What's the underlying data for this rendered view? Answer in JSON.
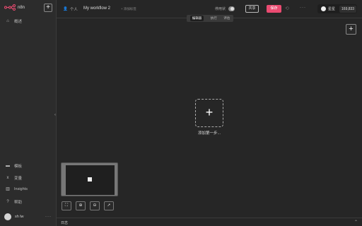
{
  "app": {
    "logo_text": "n8n",
    "brand_color": "#ea4b71"
  },
  "sidebar": {
    "top_items": [
      {
        "label": "概述",
        "icon": "home-icon"
      }
    ],
    "bottom_items": [
      {
        "label": "模板",
        "icon": "templates-icon"
      },
      {
        "label": "变量",
        "icon": "variables-icon"
      },
      {
        "label": "Insights",
        "icon": "insights-icon"
      },
      {
        "label": "帮助",
        "icon": "help-icon"
      }
    ],
    "user_name": "sh lw"
  },
  "header": {
    "breadcrumb": "个人",
    "workflow_name": "My workflow 2",
    "add_tag": "+ 添加标签",
    "status_label": "停用状",
    "share_label": "共享",
    "save_label": "保存",
    "github_label": "星星",
    "github_count": "169,833"
  },
  "tabs": {
    "items": [
      "编辑器",
      "执行",
      "评估"
    ],
    "active_index": 0
  },
  "canvas": {
    "first_step_label": "添加第一步..."
  },
  "logs": {
    "label": "日志"
  }
}
